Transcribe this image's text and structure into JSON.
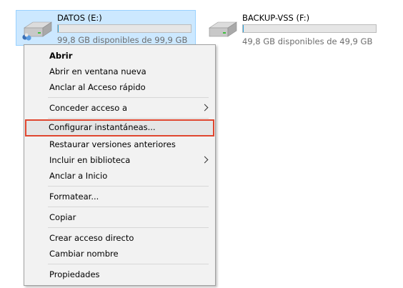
{
  "drives": [
    {
      "name": "DATOS (E:)",
      "free_text": "99,8 GB disponibles de 99,9 GB",
      "used_fraction": 0.001,
      "selected": true
    },
    {
      "name": "BACKUP-VSS (F:)",
      "free_text": "49,8 GB disponibles de 49,9 GB",
      "used_fraction": 0.002,
      "selected": false
    }
  ],
  "context_menu": {
    "items": [
      {
        "label": "Abrir",
        "default": true
      },
      {
        "label": "Abrir en ventana nueva"
      },
      {
        "label": "Anclar al Acceso rápido"
      },
      {
        "label": "Conceder acceso a",
        "submenu": true
      },
      {
        "label": "Configurar instantáneas...",
        "highlighted": true
      },
      {
        "label": "Restaurar versiones anteriores"
      },
      {
        "label": "Incluir en biblioteca",
        "submenu": true
      },
      {
        "label": "Anclar a Inicio"
      },
      {
        "label": "Formatear..."
      },
      {
        "label": "Copiar"
      },
      {
        "label": "Crear acceso directo"
      },
      {
        "label": "Cambiar nombre"
      },
      {
        "label": "Propiedades"
      }
    ]
  },
  "colors": {
    "selection": "#cce8ff",
    "highlight_border": "#e0462f",
    "bar_fill": "#26a0da"
  }
}
